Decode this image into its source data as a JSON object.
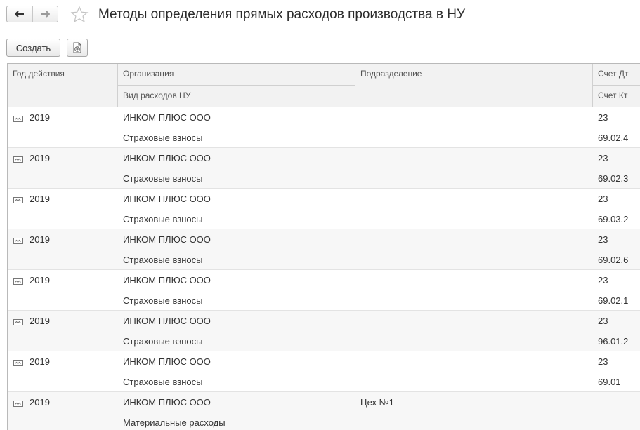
{
  "window": {
    "title": "Методы определения прямых расходов производства в НУ"
  },
  "nav": {
    "back_icon": "arrow-left-icon",
    "forward_icon": "arrow-right-icon",
    "favorite_icon": "star-icon"
  },
  "toolbar": {
    "create_label": "Создать",
    "copy_icon": "copy-document-icon"
  },
  "table": {
    "columns": {
      "year": "Год действия",
      "organization": "Организация",
      "expense_type": "Вид расходов НУ",
      "department": "Подразделение",
      "account_dt": "Счет Дт",
      "account_kt": "Счет Кт"
    },
    "rows": [
      {
        "year": "2019",
        "organization": "ИНКОМ ПЛЮС ООО",
        "expense_type": "Страховые взносы",
        "department": "",
        "account_dt": "23",
        "account_kt": "69.02.4"
      },
      {
        "year": "2019",
        "organization": "ИНКОМ ПЛЮС ООО",
        "expense_type": "Страховые взносы",
        "department": "",
        "account_dt": "23",
        "account_kt": "69.02.3"
      },
      {
        "year": "2019",
        "organization": "ИНКОМ ПЛЮС ООО",
        "expense_type": "Страховые взносы",
        "department": "",
        "account_dt": "23",
        "account_kt": "69.03.2"
      },
      {
        "year": "2019",
        "organization": "ИНКОМ ПЛЮС ООО",
        "expense_type": "Страховые взносы",
        "department": "",
        "account_dt": "23",
        "account_kt": "69.02.6"
      },
      {
        "year": "2019",
        "organization": "ИНКОМ ПЛЮС ООО",
        "expense_type": "Страховые взносы",
        "department": "",
        "account_dt": "23",
        "account_kt": "69.02.1"
      },
      {
        "year": "2019",
        "organization": "ИНКОМ ПЛЮС ООО",
        "expense_type": "Страховые взносы",
        "department": "",
        "account_dt": "23",
        "account_kt": "96.01.2"
      },
      {
        "year": "2019",
        "organization": "ИНКОМ ПЛЮС ООО",
        "expense_type": "Страховые взносы",
        "department": "",
        "account_dt": "23",
        "account_kt": "69.01"
      },
      {
        "year": "2019",
        "organization": "ИНКОМ ПЛЮС ООО",
        "expense_type": "Материальные расходы",
        "department": "Цех №1",
        "account_dt": "",
        "account_kt": ""
      }
    ],
    "row_icon": "record-icon"
  }
}
